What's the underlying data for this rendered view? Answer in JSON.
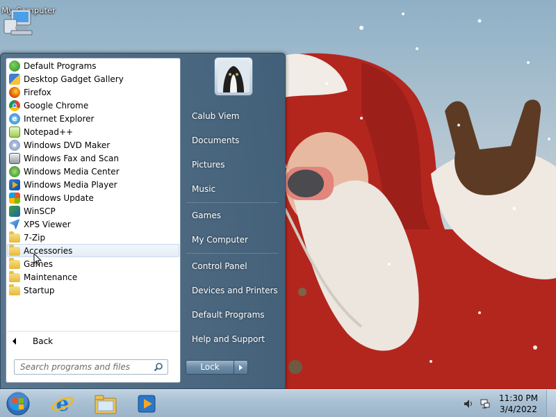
{
  "desktop": {
    "icons": [
      {
        "label": "My Computer",
        "icon": "computer-icon"
      }
    ]
  },
  "start_menu": {
    "programs": [
      {
        "label": "Default Programs",
        "icon": "default-programs-icon"
      },
      {
        "label": "Desktop Gadget Gallery",
        "icon": "gadget-gallery-icon"
      },
      {
        "label": "Firefox",
        "icon": "firefox-icon"
      },
      {
        "label": "Google Chrome",
        "icon": "chrome-icon"
      },
      {
        "label": "Internet Explorer",
        "icon": "internet-explorer-icon"
      },
      {
        "label": "Notepad++",
        "icon": "notepadpp-icon"
      },
      {
        "label": "Windows DVD Maker",
        "icon": "dvd-maker-icon"
      },
      {
        "label": "Windows Fax and Scan",
        "icon": "fax-scan-icon"
      },
      {
        "label": "Windows Media Center",
        "icon": "media-center-icon"
      },
      {
        "label": "Windows Media Player",
        "icon": "media-player-icon"
      },
      {
        "label": "Windows Update",
        "icon": "windows-update-icon"
      },
      {
        "label": "WinSCP",
        "icon": "winscp-icon"
      },
      {
        "label": "XPS Viewer",
        "icon": "xps-viewer-icon"
      },
      {
        "label": "7-Zip",
        "icon": "folder-icon"
      },
      {
        "label": "Accessories",
        "icon": "folder-icon"
      },
      {
        "label": "Games",
        "icon": "folder-icon"
      },
      {
        "label": "Maintenance",
        "icon": "folder-icon"
      },
      {
        "label": "Startup",
        "icon": "folder-icon"
      }
    ],
    "hovered_program": "Accessories",
    "back_label": "Back",
    "search_placeholder": "Search programs and files",
    "right_items": [
      "Calub Viem",
      "Documents",
      "Pictures",
      "Music",
      "Games",
      "My Computer",
      "Control Panel",
      "Devices and Printers",
      "Default Programs",
      "Help and Support"
    ],
    "shutdown_label": "Lock"
  },
  "taskbar": {
    "pinned": [
      "start-orb-icon",
      "internet-explorer-icon",
      "explorer-folder-icon",
      "media-player-icon"
    ],
    "tray": [
      "volume-icon",
      "network-icon"
    ],
    "clock_time": "11:30 PM",
    "clock_date": "3/4/2022"
  },
  "colors": {
    "accent": "#3c5a73",
    "taskbar": "#a9c0d3",
    "santa_red": "#b3261e"
  }
}
